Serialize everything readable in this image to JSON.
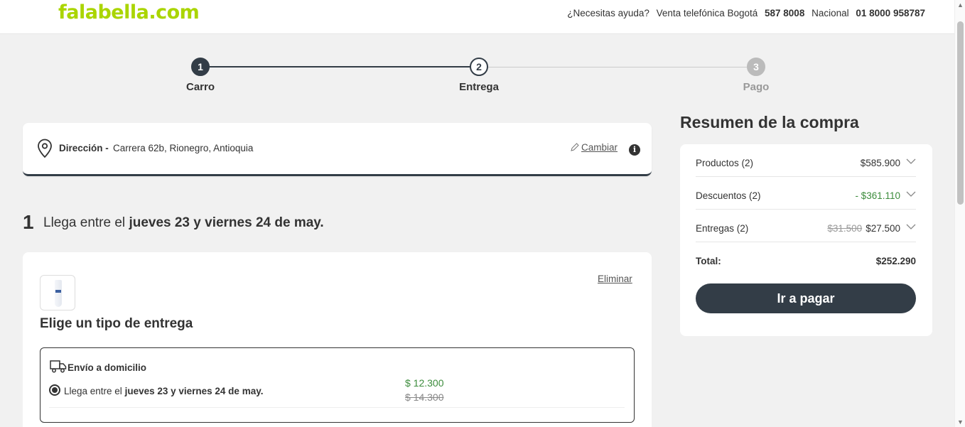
{
  "header": {
    "logo_text": "falabella",
    "logo_suffix": ".com",
    "help_question": "¿Necesitas ayuda?",
    "phone_label_city": "Venta telefónica Bogotá",
    "phone_city": "587 8008",
    "phone_label_national": "Nacional",
    "phone_national": "01 8000 958787"
  },
  "stepper": {
    "steps": [
      {
        "number": "1",
        "label": "Carro"
      },
      {
        "number": "2",
        "label": "Entrega"
      },
      {
        "number": "3",
        "label": "Pago"
      }
    ]
  },
  "address": {
    "label": "Dirección -",
    "value": "Carrera 62b, Rionegro, Antioquia",
    "change_label": "Cambiar"
  },
  "delivery": {
    "number": "1",
    "heading_prefix": "Llega entre el",
    "heading_dates": "jueves 23 y viernes 24 de may."
  },
  "product": {
    "remove_label": "Eliminar",
    "choose_title": "Elige un tipo de entrega",
    "option": {
      "title": "Envío a domicilio",
      "text_prefix": "Llega entre el",
      "text_dates": "jueves 23 y viernes 24 de may.",
      "price_new": "$ 12.300",
      "price_old": "$ 14.300",
      "selected": true
    }
  },
  "summary": {
    "title": "Resumen de la compra",
    "rows": [
      {
        "label": "Productos (2)",
        "value": "$585.900"
      },
      {
        "label": "Descuentos (2)",
        "value": "- $361.110"
      },
      {
        "label": "Entregas (2)",
        "old_value": "$31.500",
        "value": "$27.500"
      }
    ],
    "total_label": "Total:",
    "total_value": "$252.290",
    "pay_button": "Ir a pagar"
  },
  "colors": {
    "brand_green": "#aad500",
    "dark": "#333d47",
    "discount_green": "#3c8c3c"
  }
}
